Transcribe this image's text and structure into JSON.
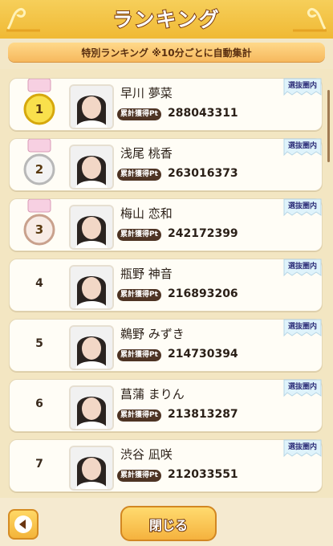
{
  "header": {
    "title": "ランキング",
    "subtitle": "特別ランキング ※10分ごとに自動集計"
  },
  "colors": {
    "accent": "#f5b23e",
    "badge": "#4e3424",
    "tag": "#2e2f7a"
  },
  "entries": [
    {
      "rank": "1",
      "medal": "gold-medal-icon",
      "name": "早川 夢菜",
      "badge": "累計獲得Pt",
      "pt": "288043311",
      "tag": "選抜圏内"
    },
    {
      "rank": "2",
      "medal": "silver-medal-icon",
      "name": "浅尾 桃香",
      "badge": "累計獲得Pt",
      "pt": "263016373",
      "tag": "選抜圏内"
    },
    {
      "rank": "3",
      "medal": "bronze-medal-icon",
      "name": "梅山 恋和",
      "badge": "累計獲得Pt",
      "pt": "242172399",
      "tag": "選抜圏内"
    },
    {
      "rank": "4",
      "name": "瓶野 神音",
      "badge": "累計獲得Pt",
      "pt": "216893206",
      "tag": "選抜圏内"
    },
    {
      "rank": "5",
      "name": "鵜野 みずき",
      "badge": "累計獲得Pt",
      "pt": "214730394",
      "tag": "選抜圏内"
    },
    {
      "rank": "6",
      "name": "菖蒲 まりん",
      "badge": "累計獲得Pt",
      "pt": "213813287",
      "tag": "選抜圏内"
    },
    {
      "rank": "7",
      "name": "渋谷 凪咲",
      "badge": "累計獲得Pt",
      "pt": "212033551",
      "tag": "選抜圏内"
    }
  ],
  "footer": {
    "back_icon": "triangle-left-icon",
    "close_label": "閉じる"
  }
}
